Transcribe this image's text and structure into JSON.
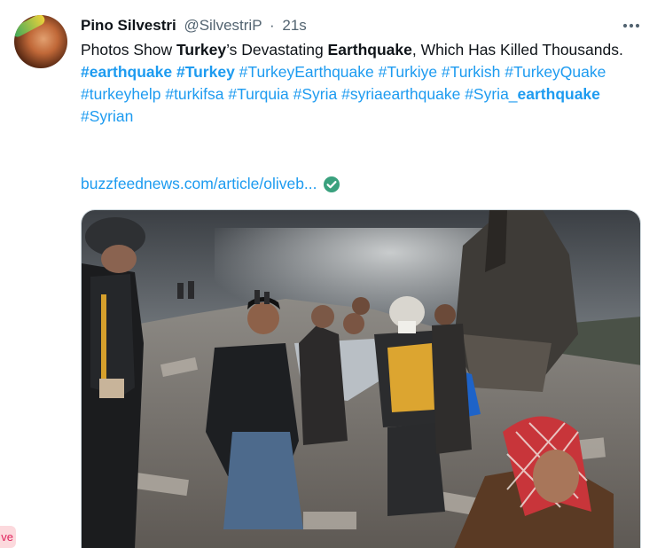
{
  "tweet": {
    "display_name": "Pino Silvestri",
    "handle": "@SilvestriP",
    "separator": "·",
    "time": "21s",
    "text_parts": [
      "Photos Show ",
      "Turkey",
      "’s Devastating ",
      "Earthquake",
      ", Which Has Killed Thousands."
    ],
    "hashtag_line": [
      {
        "text": "#earthquake",
        "bold": true
      },
      {
        "text": " ",
        "bold": false
      },
      {
        "text": "#Turkey",
        "bold": true
      },
      {
        "text": " #TurkeyEarthquake #Turkiye #Turkish #TurkeyQuake #turkeyhelp #turkifsa #Turquia #Syria #syriaearthquake #Syria_",
        "bold": false
      },
      {
        "text": "earthquake",
        "bold": true
      },
      {
        "text": " #Syrian",
        "bold": false
      }
    ],
    "link_text": "buzzfeednews.com/article/oliveb...",
    "icons": {
      "more": "more-horizontal-icon",
      "verified": "check-circle-icon"
    },
    "colors": {
      "link": "#1d9bf0",
      "verified": "#3aa17e",
      "secondary_text": "#536471"
    }
  },
  "side_tab": {
    "label": "ve"
  }
}
